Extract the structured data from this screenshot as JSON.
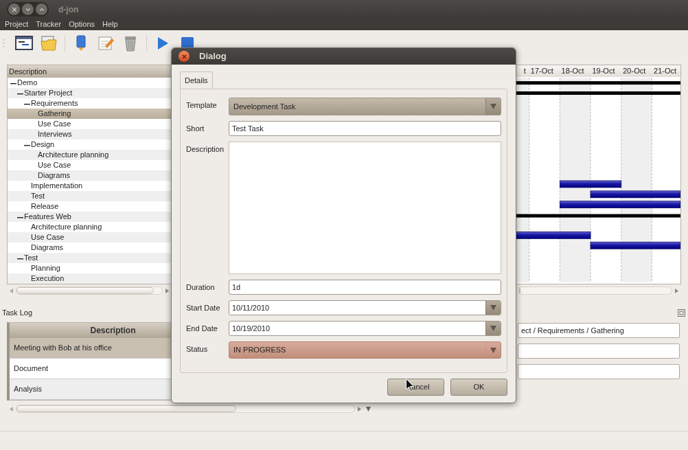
{
  "window": {
    "title": "d-jon"
  },
  "menu": [
    "Project",
    "Tracker",
    "Options",
    "Help"
  ],
  "task_tree": {
    "column": "Description",
    "rows": [
      {
        "label": "Demo",
        "expanded": true,
        "selected": false,
        "children": [
          {
            "label": "Starter Project",
            "expanded": true,
            "selected": false,
            "children": [
              {
                "label": "Requirements",
                "expanded": true,
                "selected": false,
                "children": [
                  {
                    "label": "Gathering",
                    "selected": true
                  },
                  {
                    "label": "Use Case",
                    "selected": false
                  },
                  {
                    "label": "Interviews",
                    "selected": false
                  }
                ]
              },
              {
                "label": "Design",
                "expanded": true,
                "selected": false,
                "children": [
                  {
                    "label": "Architecture planning",
                    "selected": false
                  },
                  {
                    "label": "Use Case",
                    "selected": false
                  },
                  {
                    "label": "Diagrams",
                    "selected": false
                  }
                ]
              },
              {
                "label": "Implementation",
                "selected": false
              },
              {
                "label": "Test",
                "selected": false
              },
              {
                "label": "Release",
                "selected": false
              }
            ]
          },
          {
            "label": "Features Web",
            "expanded": true,
            "selected": false,
            "children": [
              {
                "label": "Architecture planning",
                "selected": false
              },
              {
                "label": "Use Case",
                "selected": false
              },
              {
                "label": "Diagrams",
                "selected": false
              }
            ]
          },
          {
            "label": "Test",
            "expanded": true,
            "selected": false,
            "children": [
              {
                "label": "Planning",
                "selected": false
              },
              {
                "label": "Execution",
                "selected": false
              }
            ]
          }
        ]
      }
    ]
  },
  "gantt": {
    "dates": [
      "t",
      "17-Oct",
      "18-Oct",
      "19-Oct",
      "20-Oct",
      "21-Oct"
    ]
  },
  "task_log": {
    "title": "Task Log",
    "column": "Description",
    "rows": [
      {
        "description": "Meeting with Bob at his office",
        "selected": true
      },
      {
        "description": "Document",
        "selected": false
      },
      {
        "description": "Analysis",
        "selected": false
      }
    ],
    "path_field": "ect / Requirements / Gathering"
  },
  "dialog": {
    "title": "Dialog",
    "tabs": [
      {
        "label": "Details",
        "selected": true
      }
    ],
    "fields": [
      {
        "label": "Template",
        "kind": "dropdown",
        "value": "Development Task"
      },
      {
        "label": "Short",
        "kind": "text",
        "value": "Test Task"
      },
      {
        "label": "Description",
        "kind": "textarea"
      },
      {
        "label": "Duration",
        "kind": "text",
        "value": "1d"
      },
      {
        "label": "Start Date",
        "kind": "date",
        "value": "10/11/2010"
      },
      {
        "label": "End Date",
        "kind": "date",
        "value": "10/19/2010"
      },
      {
        "label": "Status",
        "kind": "status",
        "value": "IN PROGRESS"
      }
    ],
    "buttons": [
      "ancel",
      "OK"
    ]
  }
}
